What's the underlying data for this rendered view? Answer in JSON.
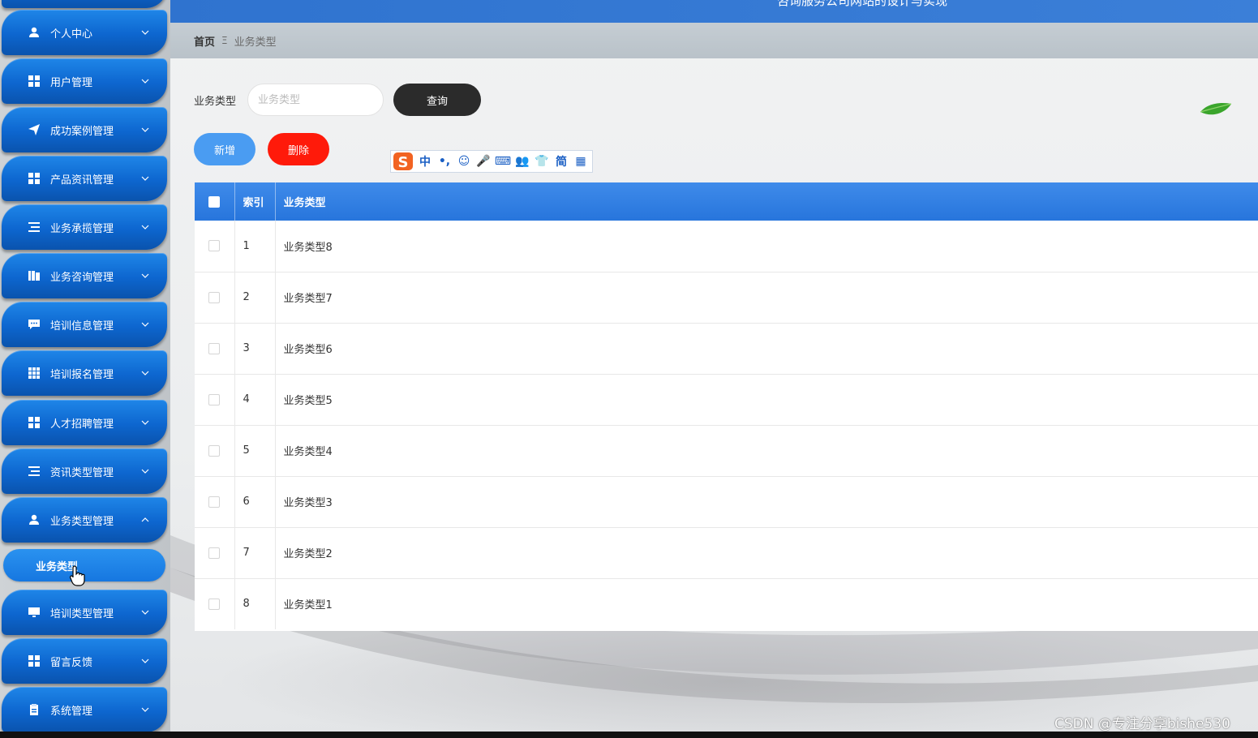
{
  "header": {
    "title": "咨询服务公司网站的设计与实现"
  },
  "sidebar": {
    "items": [
      {
        "label": "个人中心",
        "icon": "user-icon",
        "expanded": false
      },
      {
        "label": "用户管理",
        "icon": "grid-icon",
        "expanded": false
      },
      {
        "label": "成功案例管理",
        "icon": "paper-plane-icon",
        "expanded": false
      },
      {
        "label": "产品资讯管理",
        "icon": "grid-icon",
        "expanded": false
      },
      {
        "label": "业务承揽管理",
        "icon": "list-icon",
        "expanded": false
      },
      {
        "label": "业务咨询管理",
        "icon": "book-icon",
        "expanded": false
      },
      {
        "label": "培训信息管理",
        "icon": "chat-icon",
        "expanded": false
      },
      {
        "label": "培训报名管理",
        "icon": "table-icon",
        "expanded": false
      },
      {
        "label": "人才招聘管理",
        "icon": "grid-icon",
        "expanded": false
      },
      {
        "label": "资讯类型管理",
        "icon": "list-icon",
        "expanded": false
      },
      {
        "label": "业务类型管理",
        "icon": "user-icon",
        "expanded": true
      },
      {
        "label": "培训类型管理",
        "icon": "monitor-icon",
        "expanded": false
      },
      {
        "label": "留言反馈",
        "icon": "grid-icon",
        "expanded": false
      },
      {
        "label": "系统管理",
        "icon": "clipboard-icon",
        "expanded": false
      }
    ],
    "sub_item": {
      "label": "业务类型"
    }
  },
  "breadcrumb": {
    "home": "首页",
    "separator": "Ξ",
    "current": "业务类型"
  },
  "search": {
    "label": "业务类型",
    "placeholder": "业务类型",
    "value": "",
    "query_label": "查询"
  },
  "actions": {
    "add_label": "新增",
    "delete_label": "删除"
  },
  "ime": {
    "items": [
      "中",
      "•,",
      "☺",
      "🎤",
      "⌨",
      "👥",
      "👕",
      "简",
      "▦"
    ]
  },
  "table": {
    "columns": [
      "索引",
      "业务类型"
    ],
    "rows": [
      {
        "index": "1",
        "type": "业务类型8"
      },
      {
        "index": "2",
        "type": "业务类型7"
      },
      {
        "index": "3",
        "type": "业务类型6"
      },
      {
        "index": "4",
        "type": "业务类型5"
      },
      {
        "index": "5",
        "type": "业务类型4"
      },
      {
        "index": "6",
        "type": "业务类型3"
      },
      {
        "index": "7",
        "type": "业务类型2"
      },
      {
        "index": "8",
        "type": "业务类型1"
      }
    ]
  },
  "watermark": "CSDN @专注分享bishe530",
  "colors": {
    "sidebar_button": "#0d66cf",
    "topbar": "#3b7fd8",
    "table_header": "#2775dc",
    "query_button": "#2b2b2b",
    "add_button": "#4a9cf2",
    "delete_button": "#ff1a0a"
  }
}
